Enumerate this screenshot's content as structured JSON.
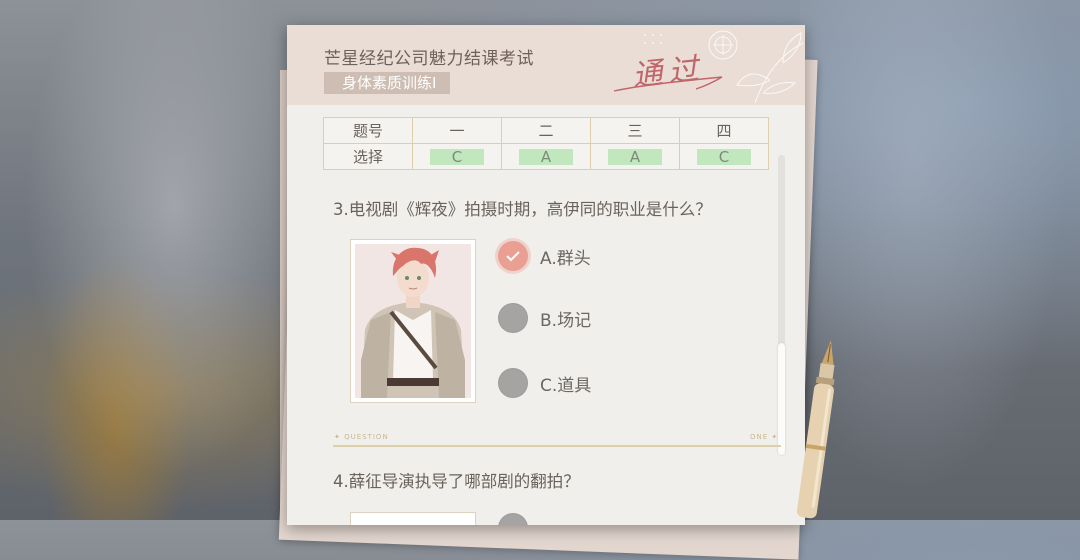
{
  "header": {
    "title": "芒星经纪公司魅力结课考试",
    "subtitle": "身体素质训练Ⅰ",
    "stamp": "通过"
  },
  "answer_table": {
    "row_header_question": "题号",
    "row_header_choice": "选择",
    "question_numbers": [
      "一",
      "二",
      "三",
      "四"
    ],
    "choices": [
      "C",
      "A",
      "A",
      "C"
    ]
  },
  "question3": {
    "text": "3.电视剧《辉夜》拍摄时期，高伊同的职业是什么？",
    "options": [
      {
        "label": "A.群头",
        "selected": true
      },
      {
        "label": "B.场记",
        "selected": false
      },
      {
        "label": "C.道具",
        "selected": false
      }
    ]
  },
  "divider": {
    "left_label": "✦ QUESTION",
    "right_label": "ONE ✦"
  },
  "question4": {
    "text": "4.薛征导演执导了哪部剧的翻拍？"
  },
  "colors": {
    "selected_radio": "#ea9f93",
    "unselected_radio": "#a5a4a3",
    "stamp": "#c0666b",
    "correct_highlight": "#96dc96"
  },
  "icons": {
    "check": "check-icon",
    "pen": "fountain-pen-icon"
  }
}
